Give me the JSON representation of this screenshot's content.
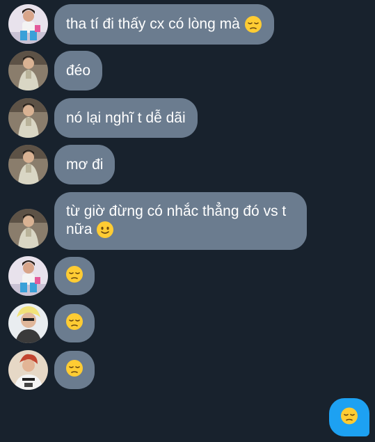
{
  "messages": [
    {
      "sender": "avatar-girl",
      "text": "tha tí đi thấy cx có lòng mà",
      "emoji": "pensive-emoji"
    },
    {
      "sender": "avatar-man",
      "text": "đéo"
    },
    {
      "sender": "avatar-man",
      "text": "nó lại nghĩ t dễ dãi"
    },
    {
      "sender": "avatar-man",
      "text": "mơ đi"
    },
    {
      "sender": "avatar-man",
      "text_line1": "từ giờ đừng có nhắc thẳng đó vs t",
      "text_line2": "nữa",
      "emoji": "slightly-smiling-emoji"
    },
    {
      "sender": "avatar-girl",
      "emoji": "pensive-emoji"
    },
    {
      "sender": "avatar-blonde",
      "emoji": "pensive-emoji"
    },
    {
      "sender": "avatar-redhair",
      "emoji": "pensive-emoji"
    }
  ],
  "outgoing": {
    "emoji": "pensive-emoji"
  },
  "colors": {
    "background": "#18222d",
    "incoming_bubble": "#6b7c8f",
    "outgoing_bubble": "#1da1f2",
    "text": "#ffffff"
  }
}
